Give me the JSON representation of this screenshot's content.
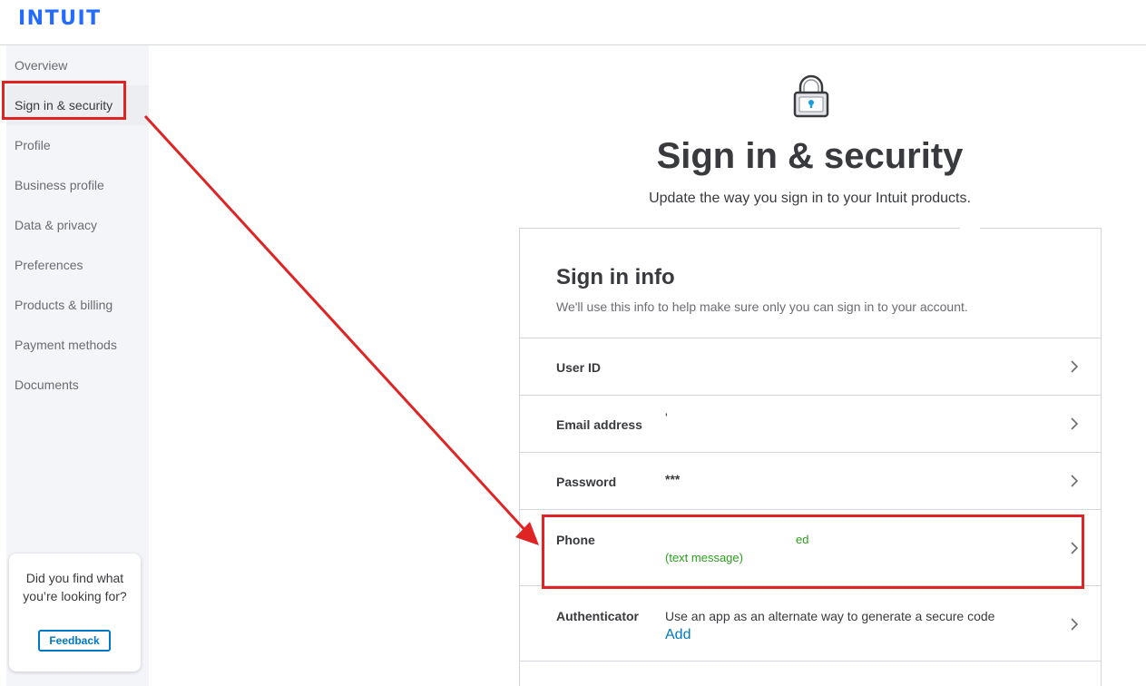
{
  "brand": {
    "logo_text": "INTUIT",
    "color": "#236cff"
  },
  "sidebar": {
    "items": [
      {
        "label": "Overview"
      },
      {
        "label": "Sign in & security",
        "active": true
      },
      {
        "label": "Profile"
      },
      {
        "label": "Business profile"
      },
      {
        "label": "Data & privacy"
      },
      {
        "label": "Preferences"
      },
      {
        "label": "Products & billing"
      },
      {
        "label": "Payment methods"
      },
      {
        "label": "Documents"
      }
    ],
    "feedback": {
      "prompt": "Did you find what you’re looking for?",
      "button": "Feedback"
    }
  },
  "main": {
    "icon": "lock-icon",
    "title": "Sign in & security",
    "subtitle": "Update the way you sign in to your Intuit products.",
    "card": {
      "title": "Sign in info",
      "description": "We'll use this info to help make sure only you can sign in to your account.",
      "rows": [
        {
          "label": "User ID",
          "value": ""
        },
        {
          "label": "Email address",
          "value": "'"
        },
        {
          "label": "Password",
          "value": "***"
        },
        {
          "label": "Phone",
          "value": "ed",
          "value_line2": "(text message)"
        },
        {
          "label": "Authenticator",
          "value": "Use an app as an alternate way to generate a secure code",
          "link": "Add"
        }
      ]
    }
  },
  "annotations": {
    "highlight_color": "#e02424"
  },
  "colors": {
    "accent": "#0077c5",
    "success": "#2ca01c",
    "text": "#393a3d"
  }
}
